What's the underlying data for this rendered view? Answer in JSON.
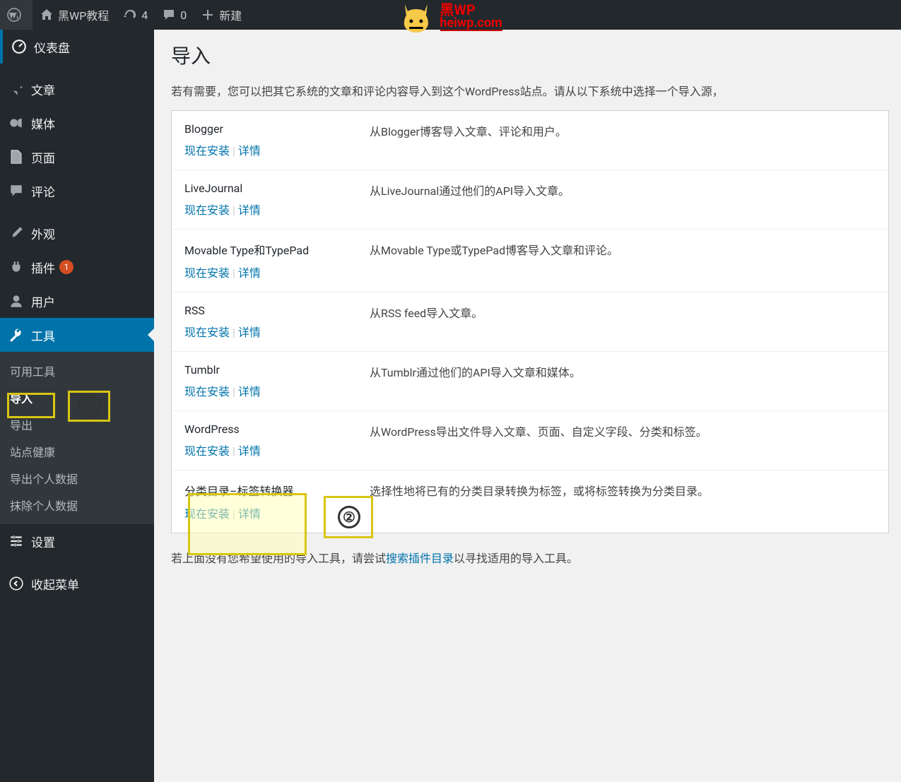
{
  "topbar": {
    "site_name": "黑WP教程",
    "updates_count": "4",
    "comments_count": "0",
    "new_label": "新建"
  },
  "watermark": {
    "line1": "黑WP",
    "line2": "heiwp.com"
  },
  "sidebar": {
    "dashboard": "仪表盘",
    "posts": "文章",
    "media": "媒体",
    "pages": "页面",
    "comments": "评论",
    "appearance": "外观",
    "plugins": "插件",
    "plugins_badge": "1",
    "users": "用户",
    "tools": "工具",
    "settings": "设置",
    "collapse": "收起菜单",
    "sub": {
      "available": "可用工具",
      "import": "导入",
      "export": "导出",
      "health": "站点健康",
      "export_personal": "导出个人数据",
      "erase_personal": "抹除个人数据"
    }
  },
  "page": {
    "title": "导入",
    "intro": "若有需要，您可以把其它系统的文章和评论内容导入到这个WordPress站点。请从以下系统中选择一个导入源，",
    "link_install": "现在安装",
    "link_details": "详情",
    "footer_prefix": "若上面没有您希望使用的导入工具，请尝试",
    "footer_link": "搜索插件目录",
    "footer_suffix": "以寻找适用的导入工具。"
  },
  "importers": [
    {
      "name": "Blogger",
      "desc": "从Blogger博客导入文章、评论和用户。"
    },
    {
      "name": "LiveJournal",
      "desc": "从LiveJournal通过他们的API导入文章。"
    },
    {
      "name": "Movable Type和TypePad",
      "desc": "从Movable Type或TypePad博客导入文章和评论。"
    },
    {
      "name": "RSS",
      "desc": "从RSS feed导入文章。"
    },
    {
      "name": "Tumblr",
      "desc": "从Tumblr通过他们的API导入文章和媒体。"
    },
    {
      "name": "WordPress",
      "desc": "从WordPress导出文件导入文章、页面、自定义字段、分类和标签。"
    },
    {
      "name": "分类目录–标签转换器",
      "desc": "选择性地将已有的分类目录转换为标签，或将标签转换为分类目录。"
    }
  ],
  "annotations": {
    "one": "①",
    "two": "②"
  }
}
